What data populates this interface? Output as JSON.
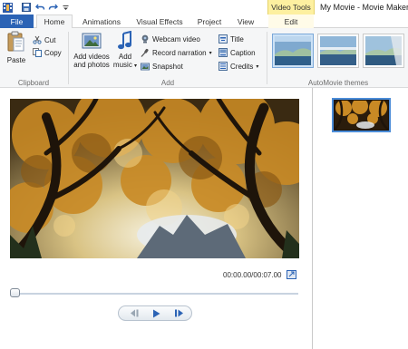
{
  "window": {
    "title": "My Movie - Movie Maker",
    "contextual_tab_group": "Video Tools"
  },
  "quick_access": {
    "icons": [
      "app-icon",
      "save-icon",
      "undo-icon",
      "redo-icon",
      "dropdown-icon"
    ]
  },
  "tabs": [
    {
      "label": "File"
    },
    {
      "label": "Home"
    },
    {
      "label": "Animations"
    },
    {
      "label": "Visual Effects"
    },
    {
      "label": "Project"
    },
    {
      "label": "View"
    },
    {
      "label": "Edit"
    }
  ],
  "ribbon": {
    "clipboard": {
      "group_label": "Clipboard",
      "paste": "Paste",
      "cut": "Cut",
      "copy": "Copy"
    },
    "add": {
      "group_label": "Add",
      "add_videos_line1": "Add videos",
      "add_videos_line2": "and photos",
      "add_music_line1": "Add",
      "add_music_line2": "music",
      "webcam_video": "Webcam video",
      "record_narration": "Record narration",
      "snapshot": "Snapshot",
      "title": "Title",
      "caption": "Caption",
      "credits": "Credits"
    },
    "automovie": {
      "group_label": "AutoMovie themes",
      "theme_count": 3,
      "selected_index": 0
    }
  },
  "preview": {
    "time_display": "00:00.00/00:07.00",
    "seek_position": 0
  },
  "colors": {
    "file_tab": "#2b63b5",
    "video_tools": "#fdf0a0",
    "selection": "#4b8cd8",
    "ribbon_bg": "#f5f6f7"
  }
}
